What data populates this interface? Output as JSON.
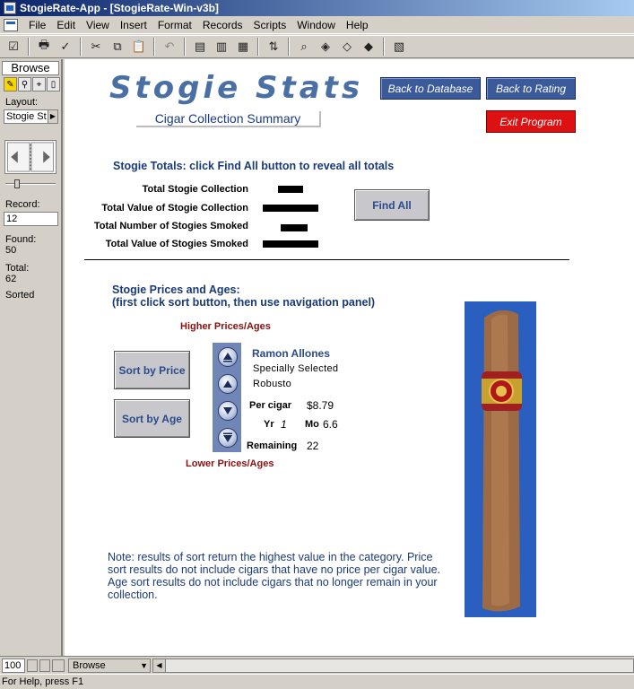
{
  "window": {
    "title": "StogieRate-App - [StogieRate-Win-v3b]"
  },
  "menu": [
    "File",
    "Edit",
    "View",
    "Insert",
    "Format",
    "Records",
    "Scripts",
    "Window",
    "Help"
  ],
  "status_area": {
    "mode": "Browse",
    "layout_label": "Layout:",
    "layout_value": "Stogie St",
    "record_label": "Record:",
    "record_value": "12",
    "found_label": "Found:",
    "found_value": "50",
    "total_label": "Total:",
    "total_value": "62",
    "sorted_label": "Sorted"
  },
  "header": {
    "title": "Stogie Stats",
    "subtitle": "Cigar Collection Summary",
    "back_db": "Back to Database",
    "back_rating": "Back to Rating",
    "exit": "Exit Program"
  },
  "totals": {
    "heading": "Stogie Totals: click Find All button to reveal all totals",
    "labels": [
      "Total Stogie Collection",
      "Total Value of Stogie Collection",
      "Total Number of Stogies Smoked",
      "Total Value of Stogies Smoked"
    ],
    "find_all": "Find All"
  },
  "prices_ages": {
    "heading_line1": "Stogie Prices and Ages:",
    "heading_line2": "(first click sort button, then use navigation panel)",
    "higher": "Higher Prices/Ages",
    "lower": "Lower Prices/Ages",
    "sort_price": "Sort by Price",
    "sort_age": "Sort by Age",
    "cigar_name": "Ramon Allones",
    "cigar_line": "Specially Selected",
    "cigar_size": "Robusto",
    "per_cigar_label": "Per cigar",
    "per_cigar_value": "$8.79",
    "yr_label": "Yr",
    "yr_value": "1",
    "mo_label": "Mo",
    "mo_value": "6.6",
    "remaining_label": "Remaining",
    "remaining_value": "22"
  },
  "note": "Note: results of sort return the highest value in the category. Price sort results do not include cigars that have no price per cigar value. Age sort results do not include cigars that no longer remain in your collection.",
  "bottom": {
    "zoom": "100",
    "mode_popup": "Browse"
  },
  "statusbar": {
    "text": "For Help, press F1"
  },
  "colors": {
    "title_blue": "#4a6fa5",
    "nav_panel": "#6f86b6",
    "exit_red": "#dd1111",
    "cigar_bg": "#2a5fc0"
  }
}
